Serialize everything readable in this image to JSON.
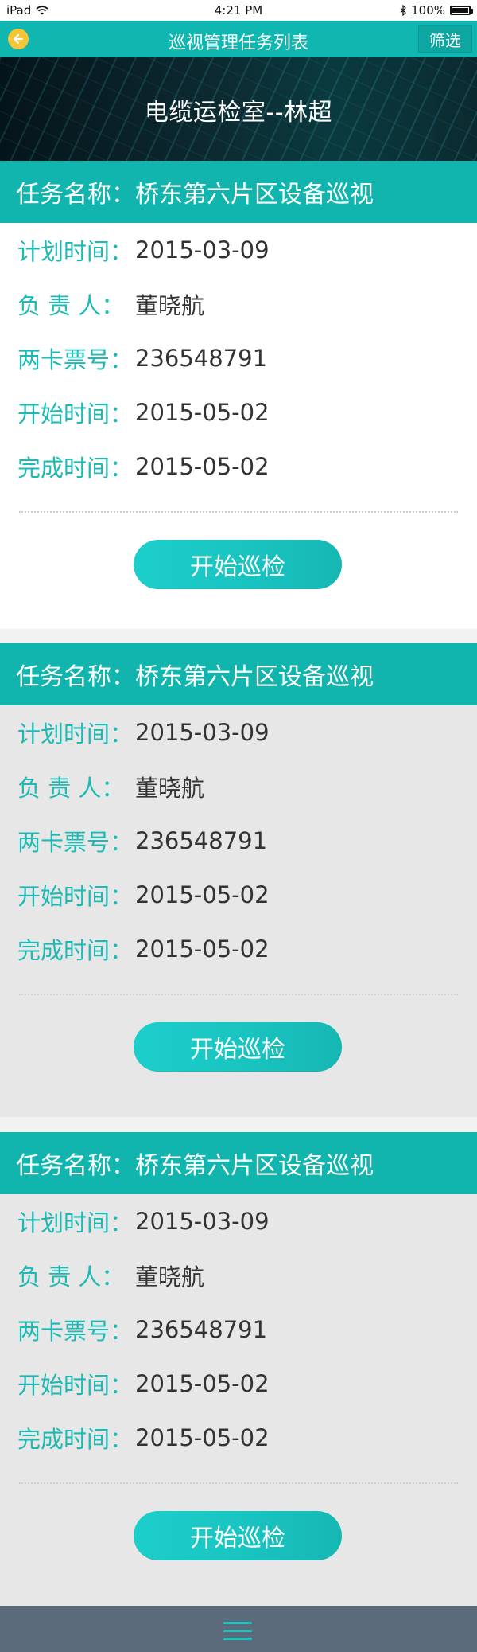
{
  "status_bar": {
    "device": "iPad",
    "time": "4:21 PM",
    "battery": "100%",
    "icons": [
      "wifi-icon",
      "bluetooth-icon",
      "battery-icon"
    ]
  },
  "nav": {
    "title": "巡视管理任务列表",
    "filter_label": "筛选",
    "back_icon": "back-arrow-icon"
  },
  "hero": {
    "title": "电缆运检室--林超"
  },
  "tasks": [
    {
      "name_label": "任务名称：",
      "name_value": "桥东第六片区设备巡视",
      "plan_label": "计划时间：",
      "plan_value": "2015-03-09",
      "owner_label": "负 责 人：",
      "owner_value": "董晓航",
      "ticket_label": "两卡票号：",
      "ticket_value": "236548791",
      "start_label": "开始时间：",
      "start_value": "2015-05-02",
      "finish_label": "完成时间：",
      "finish_value": "2015-05-02",
      "button_label": "开始巡检"
    },
    {
      "name_label": "任务名称：",
      "name_value": "桥东第六片区设备巡视",
      "plan_label": "计划时间：",
      "plan_value": "2015-03-09",
      "owner_label": "负 责 人：",
      "owner_value": "董晓航",
      "ticket_label": "两卡票号：",
      "ticket_value": "236548791",
      "start_label": "开始时间：",
      "start_value": "2015-05-02",
      "finish_label": "完成时间：",
      "finish_value": "2015-05-02",
      "button_label": "开始巡检"
    },
    {
      "name_label": "任务名称：",
      "name_value": "桥东第六片区设备巡视",
      "plan_label": "计划时间：",
      "plan_value": "2015-03-09",
      "owner_label": "负 责 人：",
      "owner_value": "董晓航",
      "ticket_label": "两卡票号：",
      "ticket_value": "236548791",
      "start_label": "开始时间：",
      "start_value": "2015-05-02",
      "finish_label": "完成时间：",
      "finish_value": "2015-05-02",
      "button_label": "开始巡检"
    }
  ],
  "bottom_bar": {
    "menu_icon": "hamburger-menu-icon"
  },
  "colors": {
    "accent": "#12b5ae",
    "label": "#1bbab4",
    "button": "#1ccfcb",
    "bottom_bar": "#5b6b7c"
  }
}
